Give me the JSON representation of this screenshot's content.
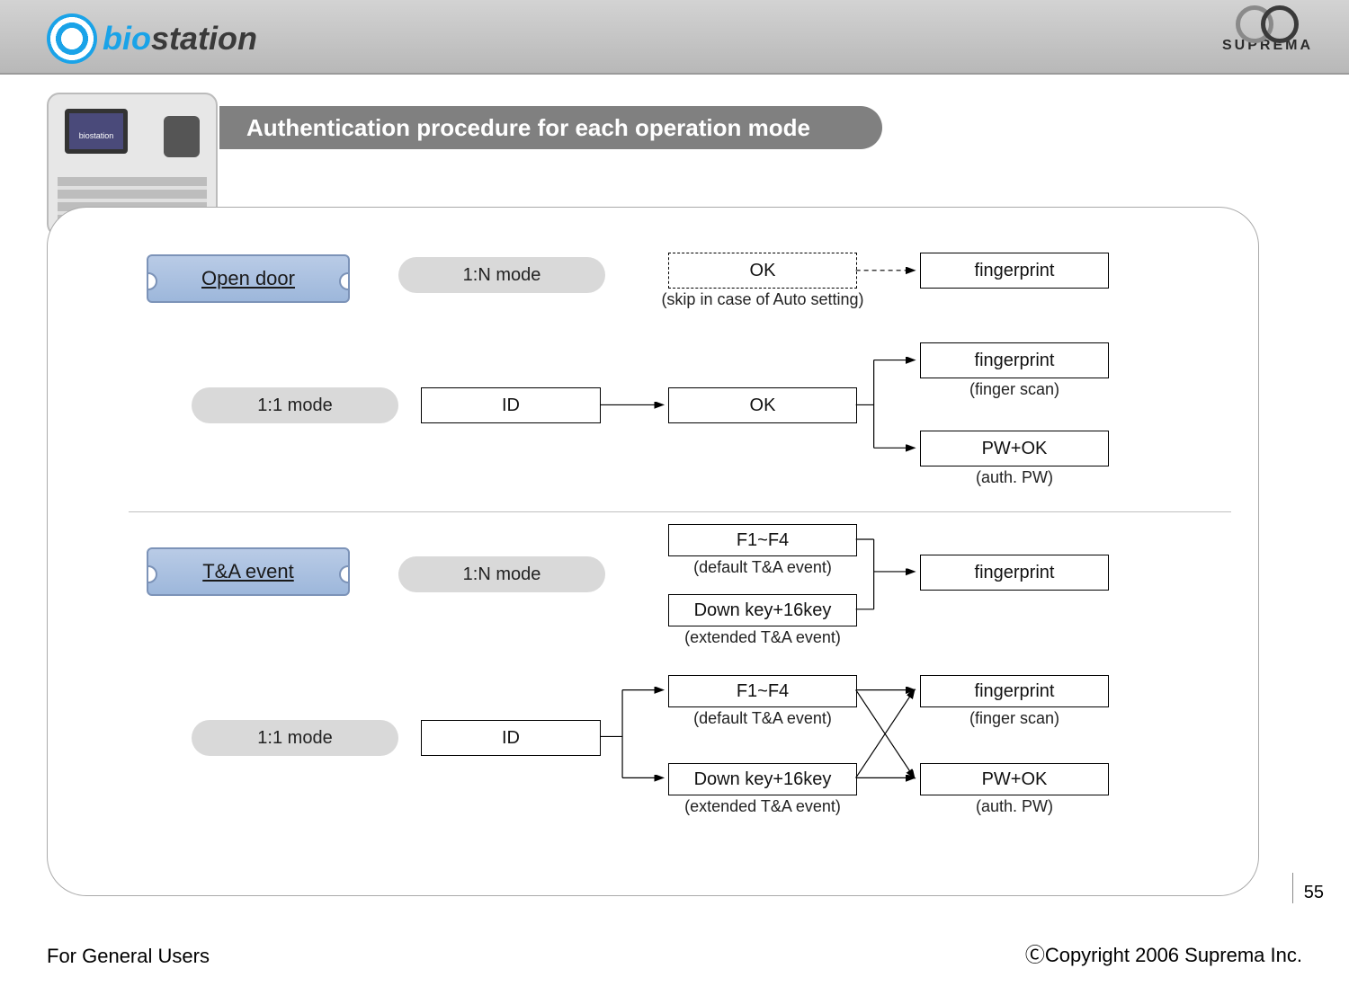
{
  "brand": {
    "left1": "bio",
    "left2": "station",
    "right": "SUPREMA"
  },
  "title": "Authentication procedure for each operation mode",
  "tickets": {
    "open_door": "Open door",
    "ta_event": "T&A event"
  },
  "modes": {
    "oneN": "1:N mode",
    "one1": "1:1 mode"
  },
  "steps": {
    "ok": "OK",
    "ok_skip_caption": "(skip in case of Auto setting)",
    "id": "ID",
    "fingerprint": "fingerprint",
    "finger_scan_caption": "(finger scan)",
    "pw_ok": "PW+OK",
    "auth_pw_caption": "(auth. PW)",
    "f1f4": "F1~F4",
    "f1f4_caption": "(default T&A event)",
    "down16": "Down key+16key",
    "down16_caption": "(extended T&A event)"
  },
  "footer": {
    "page": "55",
    "left": "For General Users",
    "right": "ⒸCopyright 2006 Suprema Inc."
  },
  "chart_data": {
    "type": "flow",
    "title": "Authentication procedure for each operation mode",
    "sections": [
      {
        "name": "Open door",
        "rows": [
          {
            "mode": "1:N mode",
            "flow": [
              {
                "id": "ok_dashed",
                "label": "OK",
                "style": "dashed",
                "note": "(skip in case of Auto setting)"
              },
              {
                "id": "fp1",
                "label": "fingerprint"
              }
            ],
            "edges": [
              [
                "ok_dashed",
                "fp1",
                "dashed"
              ]
            ]
          },
          {
            "mode": "1:1 mode",
            "flow": [
              {
                "id": "id1",
                "label": "ID"
              },
              {
                "id": "ok1",
                "label": "OK"
              },
              {
                "id": "fp2",
                "label": "fingerprint",
                "note": "(finger scan)"
              },
              {
                "id": "pw1",
                "label": "PW+OK",
                "note": "(auth. PW)"
              }
            ],
            "edges": [
              [
                "id1",
                "ok1"
              ],
              [
                "ok1",
                "fp2"
              ],
              [
                "ok1",
                "pw1"
              ]
            ]
          }
        ]
      },
      {
        "name": "T&A event",
        "rows": [
          {
            "mode": "1:N mode",
            "flow": [
              {
                "id": "f1a",
                "label": "F1~F4",
                "note": "(default T&A event)"
              },
              {
                "id": "d1a",
                "label": "Down key+16key",
                "note": "(extended T&A event)"
              },
              {
                "id": "fp3",
                "label": "fingerprint"
              }
            ],
            "edges": [
              [
                "f1a",
                "fp3"
              ],
              [
                "d1a",
                "fp3"
              ]
            ]
          },
          {
            "mode": "1:1 mode",
            "flow": [
              {
                "id": "id2",
                "label": "ID"
              },
              {
                "id": "f1b",
                "label": "F1~F4",
                "note": "(default T&A event)"
              },
              {
                "id": "d1b",
                "label": "Down key+16key",
                "note": "(extended T&A event)"
              },
              {
                "id": "fp4",
                "label": "fingerprint",
                "note": "(finger scan)"
              },
              {
                "id": "pw2",
                "label": "PW+OK",
                "note": "(auth. PW)"
              }
            ],
            "edges": [
              [
                "id2",
                "f1b"
              ],
              [
                "id2",
                "d1b"
              ],
              [
                "f1b",
                "fp4"
              ],
              [
                "f1b",
                "pw2"
              ],
              [
                "d1b",
                "fp4"
              ],
              [
                "d1b",
                "pw2"
              ]
            ]
          }
        ]
      }
    ]
  }
}
